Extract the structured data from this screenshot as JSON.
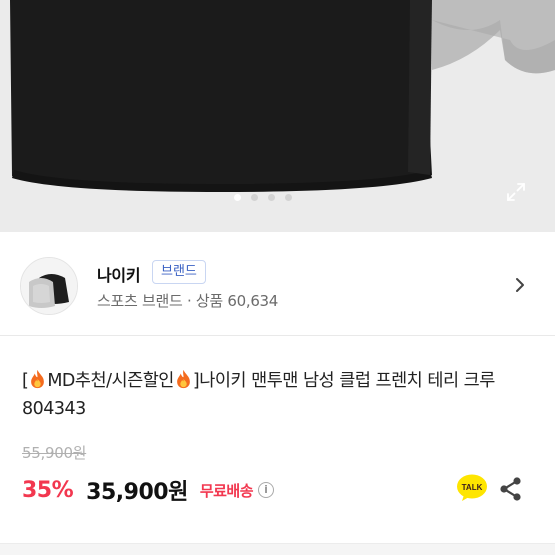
{
  "gallery": {
    "dots_total": 4,
    "active_index": 0,
    "expand_icon": "expand-icon"
  },
  "seller": {
    "name": "나이키",
    "badge": "브랜드",
    "category": "스포츠 브랜드",
    "separator": "·",
    "products_label": "상품",
    "products_count": "60,634",
    "chevron_icon": "chevron-right-icon"
  },
  "product": {
    "title_part1": "[",
    "title_part2": "MD추천/시즌할인",
    "title_part3": "]나이키 맨투맨 남성 클럽 프렌치 테리 크루 804343",
    "title_icon": "fire-icon",
    "original_price": "55,900원",
    "discount": "35%",
    "price": "35,900원",
    "shipping": "무료배송",
    "shipping_info_icon": "info-icon"
  },
  "actions": {
    "talk_label": "TALK",
    "talk_icon": "kakaotalk-icon",
    "share_icon": "share-icon"
  },
  "colors": {
    "accent_red": "#f2374f",
    "badge_blue": "#3b62c4",
    "kakao_yellow": "#fee500"
  }
}
